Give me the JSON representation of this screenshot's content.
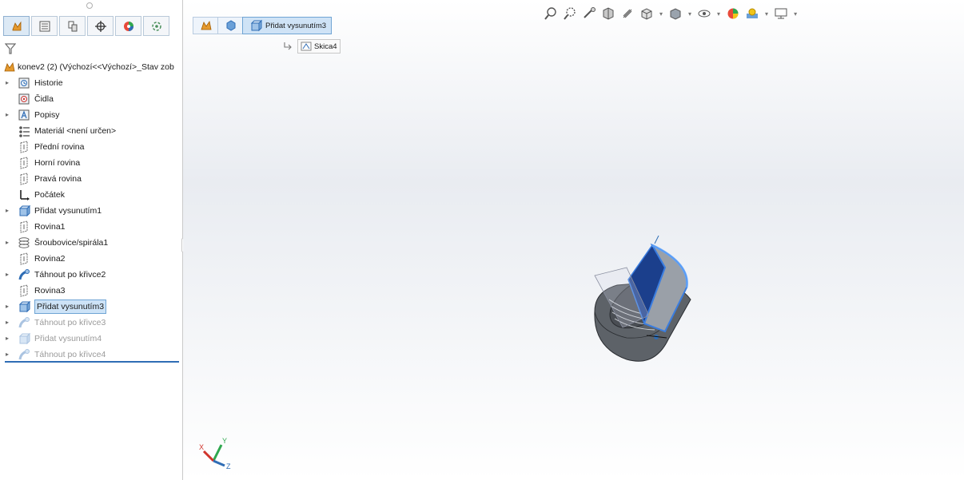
{
  "panel": {
    "tabs": [
      {
        "icon": "feature-manager-icon",
        "active": true
      },
      {
        "icon": "property-manager-icon"
      },
      {
        "icon": "configuration-manager-icon"
      },
      {
        "icon": "dimxpert-manager-icon"
      },
      {
        "icon": "display-manager-icon"
      },
      {
        "icon": "cam-manager-icon"
      }
    ],
    "filter_icon": "filter-icon",
    "tree": {
      "root": "konev2 (2)  (Výchozí<<Výchozí>_Stav zob",
      "items": [
        {
          "label": "Historie",
          "icon": "history-icon",
          "expandable": true
        },
        {
          "label": "Čidla",
          "icon": "sensors-icon",
          "expandable": false
        },
        {
          "label": "Popisy",
          "icon": "annotations-icon",
          "expandable": true
        },
        {
          "label": "Materiál <není určen>",
          "icon": "material-icon",
          "expandable": false
        },
        {
          "label": "Přední rovina",
          "icon": "plane-icon",
          "expandable": false
        },
        {
          "label": "Horní rovina",
          "icon": "plane-icon",
          "expandable": false
        },
        {
          "label": "Pravá rovina",
          "icon": "plane-icon",
          "expandable": false
        },
        {
          "label": "Počátek",
          "icon": "origin-icon",
          "expandable": false
        },
        {
          "label": "Přidat vysunutím1",
          "icon": "extrude-icon",
          "expandable": true
        },
        {
          "label": "Rovina1",
          "icon": "plane-icon",
          "expandable": false
        },
        {
          "label": "Šroubovice/spirála1",
          "icon": "helix-icon",
          "expandable": true
        },
        {
          "label": "Rovina2",
          "icon": "plane-icon",
          "expandable": false
        },
        {
          "label": "Táhnout po křivce2",
          "icon": "sweep-icon",
          "expandable": true
        },
        {
          "label": "Rovina3",
          "icon": "plane-icon",
          "expandable": false
        },
        {
          "label": "Přidat vysunutím3",
          "icon": "extrude-icon",
          "expandable": true,
          "selected": true
        },
        {
          "label": "Táhnout po křivce3",
          "icon": "sweep-icon",
          "expandable": true,
          "suppressed": true
        },
        {
          "label": "Přidat vysunutím4",
          "icon": "extrude-icon",
          "expandable": true,
          "suppressed": true
        },
        {
          "label": "Táhnout po křivce4",
          "icon": "sweep-icon",
          "expandable": true,
          "suppressed": true
        }
      ]
    }
  },
  "breadcrumb": {
    "items": [
      {
        "icon": "part-icon"
      },
      {
        "icon": "body-icon"
      },
      {
        "icon": "extrude-icon",
        "label": "Přidat vysunutím3"
      }
    ],
    "sub": {
      "icon": "sketch-icon",
      "label": "Skica4"
    }
  },
  "headsup_toolbar": [
    "zoom-to-fit-icon",
    "zoom-to-area-icon",
    "previous-view-icon",
    "section-view-icon",
    "dynamic-annotation-icon",
    "view-orientation-icon",
    "display-style-icon",
    "hide-show-icon",
    "edit-appearance-icon",
    "scene-icon",
    "view-settings-icon"
  ],
  "triad": {
    "x": "X",
    "y": "Y",
    "z": "Z"
  },
  "colors": {
    "accent": "#2f6db5",
    "selection_bg": "#cde3f7",
    "model_gray": "#5d6268",
    "highlight": "#3a7de0"
  }
}
